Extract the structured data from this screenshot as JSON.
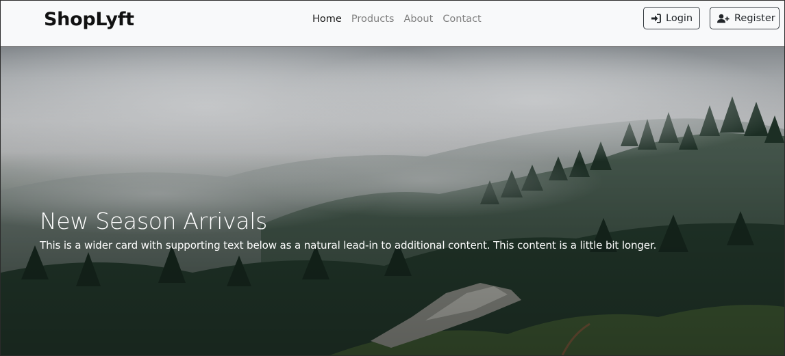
{
  "brand": {
    "name": "ShopLyft"
  },
  "nav": {
    "items": [
      {
        "label": "Home",
        "active": true
      },
      {
        "label": "Products",
        "active": false
      },
      {
        "label": "About",
        "active": false
      },
      {
        "label": "Contact",
        "active": false
      }
    ]
  },
  "auth": {
    "login_label": "Login",
    "login_icon": "sign-in-icon",
    "register_label": "Register",
    "register_icon": "user-plus-icon"
  },
  "hero": {
    "title": "New Season Arrivals",
    "text": "This is a wider card with supporting text below as a natural lead-in to additional content. This content is a little bit longer.",
    "image": "misty-forest-hillside"
  },
  "colors": {
    "navbar_bg": "#f8f9fa",
    "nav_active": "#1a1a1a",
    "nav_inactive": "#808080",
    "button_border": "#343a40",
    "hero_text": "#ffffff"
  }
}
